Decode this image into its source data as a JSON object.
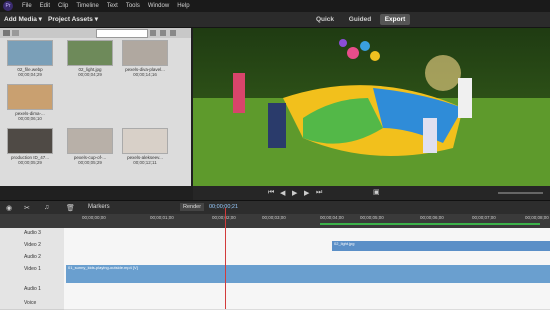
{
  "menu": {
    "logo": "Pr",
    "items": [
      "File",
      "Edit",
      "Clip",
      "Timeline",
      "Text",
      "Tools",
      "Window",
      "Help"
    ]
  },
  "toolbar": {
    "add_media": "Add Media ▾",
    "project_assets": "Project Assets ▾",
    "modes": [
      "Quick",
      "Guided",
      "Export"
    ],
    "active_mode": "Export"
  },
  "assets": [
    {
      "name": "02_file.webp",
      "dur": "00;00;04;29",
      "color": "#7a9fb8"
    },
    {
      "name": "02_light.jpg",
      "dur": "00;00;04;29",
      "color": "#6e8a5a"
    },
    {
      "name": "pexels-diva-plavel...",
      "dur": "00;00;14;16",
      "color": "#b0a8a0"
    },
    {
      "name": "pexels-dima-...",
      "dur": "00;00;06;10",
      "color": "#c9a070"
    },
    {
      "name": "production ID_47...",
      "dur": "00;00;05;29",
      "color": "#4f4a45"
    },
    {
      "name": "pexels-cup-of-...",
      "dur": "00;00;05;29",
      "color": "#b8b0a8"
    },
    {
      "name": "pexels-alekseev...",
      "dur": "00;00;12;11",
      "color": "#d8d0c8"
    }
  ],
  "transport": {
    "render": "Render",
    "timecode": "00;00;00;21"
  },
  "timeline": {
    "markers_label": "Markers",
    "ruler_ticks": [
      "00;00;00;00",
      "00;00;01;00",
      "00;00;02;00",
      "00;00;03;00",
      "00;00;04;00",
      "00;00;05;00",
      "00;00;06;00",
      "00;00;07;00",
      "00;00;08;00"
    ],
    "tracks": [
      "Audio 3",
      "Video 2",
      "Audio 2",
      "Video 1",
      "Audio 1",
      "Voice"
    ],
    "video1_clip": "01_sunny_kids-playing-outside.mp4 [V]",
    "video2_clip": "02_light.jpg"
  }
}
